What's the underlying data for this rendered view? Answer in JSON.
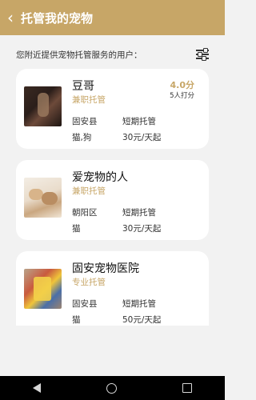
{
  "header": {
    "title": "托管我的宠物"
  },
  "intro": {
    "text": "您附近提供宠物托管服务的用户："
  },
  "cards": [
    {
      "name": "豆哥",
      "tag": "兼职托管",
      "location": "固安县",
      "duration": "短期托管",
      "pets": "猫,狗",
      "price": "30元/天起",
      "rating": "4.0分",
      "raters": "5人打分"
    },
    {
      "name": "爱宠物的人",
      "tag": "兼职托管",
      "location": "朝阳区",
      "duration": "短期托管",
      "pets": "猫",
      "price": "30元/天起"
    },
    {
      "name": "固安宠物医院",
      "tag": "专业托管",
      "location": "固安县",
      "duration": "短期托管",
      "pets": "猫",
      "price": "50元/天起"
    }
  ],
  "icons": {
    "back": "chevron-left-icon",
    "filter": "sliders-icon",
    "nav": [
      "triangle-back-icon",
      "circle-home-icon",
      "square-recents-icon"
    ]
  },
  "colors": {
    "accent": "#c7a667",
    "background": "#f2f2f2"
  }
}
